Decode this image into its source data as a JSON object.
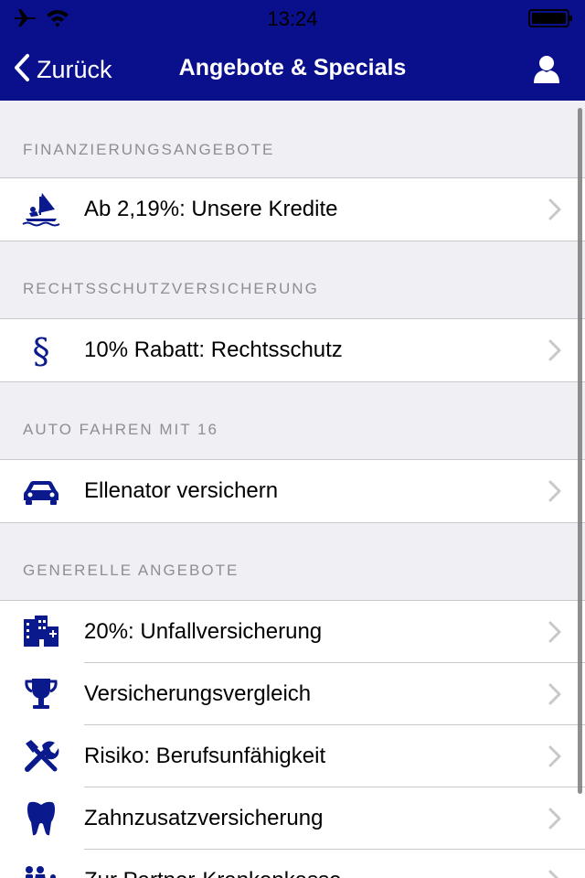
{
  "status_bar": {
    "time": "13:24",
    "icons": [
      "airplane-icon",
      "wifi-icon",
      "battery-icon"
    ]
  },
  "nav": {
    "back_label": "Zurück",
    "title": "Angebote & Specials",
    "profile_icon": "person-icon",
    "background_color": "#0a0f8c"
  },
  "sections": [
    {
      "header": "FINANZIERUNGSANGEBOTE",
      "items": [
        {
          "label": "Ab 2,19%: Unsere Kredite",
          "icon": "windsurfer-icon"
        }
      ]
    },
    {
      "header": "RECHTSSCHUTZVERSICHERUNG",
      "items": [
        {
          "label": "10% Rabatt: Rechtsschutz",
          "icon": "paragraph-icon"
        }
      ]
    },
    {
      "header": "AUTO FAHREN MIT 16",
      "items": [
        {
          "label": "Ellenator versichern",
          "icon": "car-icon"
        }
      ]
    },
    {
      "header": "GENERELLE ANGEBOTE",
      "items": [
        {
          "label": "20%: Unfallversicherung",
          "icon": "hospital-icon"
        },
        {
          "label": "Versicherungsvergleich",
          "icon": "trophy-icon"
        },
        {
          "label": "Risiko: Berufsunfähigkeit",
          "icon": "tools-icon"
        },
        {
          "label": "Zahnzusatzversicherung",
          "icon": "tooth-icon"
        },
        {
          "label": "Zur Partner-Krankenkasse",
          "icon": "family-icon"
        }
      ]
    }
  ],
  "colors": {
    "accent": "#0a0f8c",
    "icon": "#0a1a8c",
    "chevron": "#c7c7cc",
    "section_text": "#8e8e93"
  }
}
